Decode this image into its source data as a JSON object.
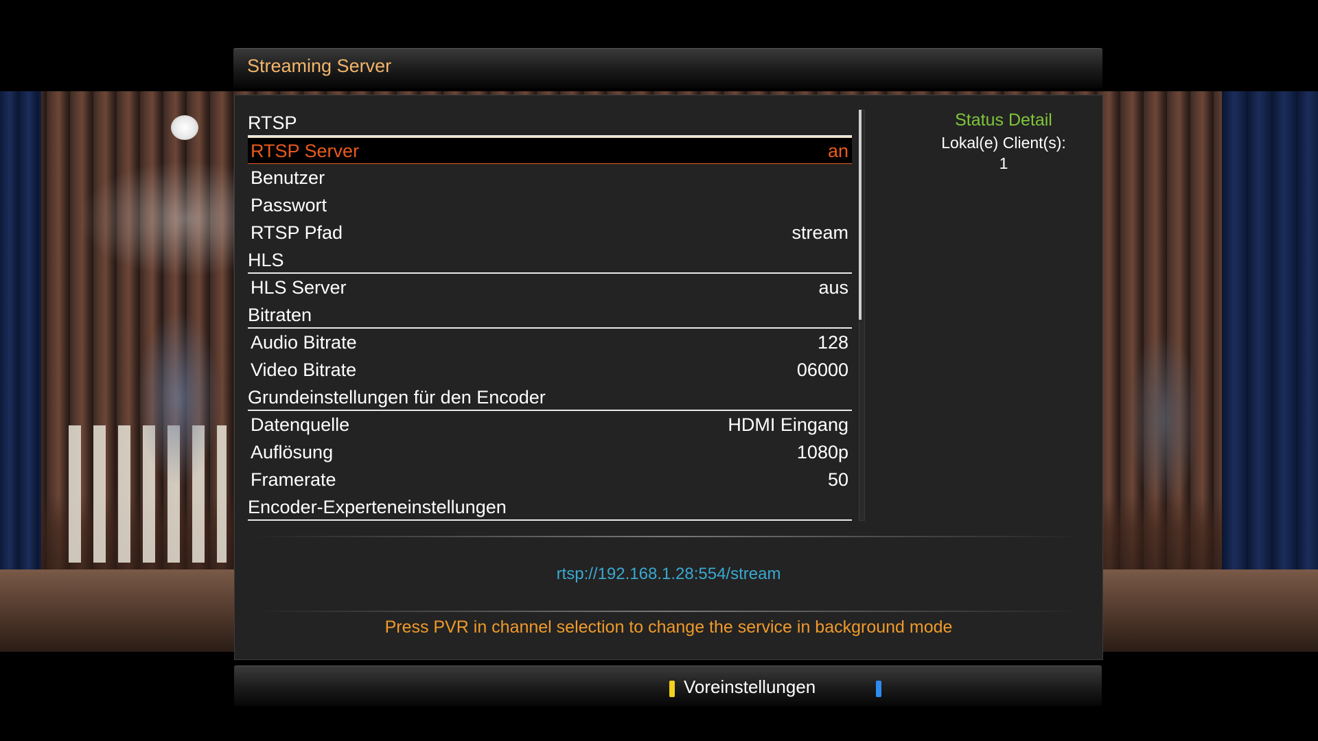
{
  "window": {
    "title": "Streaming Server"
  },
  "settings": {
    "rows": [
      {
        "type": "section",
        "label": "RTSP"
      },
      {
        "type": "item",
        "label": "RTSP Server",
        "value": "an",
        "selected": true
      },
      {
        "type": "item",
        "label": "Benutzer",
        "value": ""
      },
      {
        "type": "item",
        "label": "Passwort",
        "value": ""
      },
      {
        "type": "item",
        "label": "RTSP Pfad",
        "value": "stream"
      },
      {
        "type": "section",
        "label": "HLS"
      },
      {
        "type": "item",
        "label": "HLS Server",
        "value": "aus"
      },
      {
        "type": "section",
        "label": "Bitraten"
      },
      {
        "type": "item",
        "label": "Audio Bitrate",
        "value": "128"
      },
      {
        "type": "item",
        "label": "Video Bitrate",
        "value": "06000"
      },
      {
        "type": "section",
        "label": "Grundeinstellungen für den Encoder"
      },
      {
        "type": "item",
        "label": "Datenquelle",
        "value": "HDMI Eingang"
      },
      {
        "type": "item",
        "label": "Auflösung",
        "value": "1080p"
      },
      {
        "type": "item",
        "label": "Framerate",
        "value": "50"
      },
      {
        "type": "section",
        "label": "Encoder-Experteneinstellungen"
      }
    ]
  },
  "status": {
    "title": "Status Detail",
    "clients_label": "Lokal(e) Client(s):",
    "clients_count": "1"
  },
  "stream_url": "rtsp://192.168.1.28:554/stream",
  "hint": "Press PVR in channel selection to change the service in background mode",
  "buttons": {
    "yellow_label": "Voreinstellungen",
    "yellow_color": "#f4d21c",
    "blue_label": "",
    "blue_color": "#2e8bf0"
  },
  "colors": {
    "title": "#f3b56a",
    "selected": "#e85a1e",
    "status_title": "#7fc63a",
    "url": "#3ba8d0",
    "hint": "#f09a2a"
  }
}
